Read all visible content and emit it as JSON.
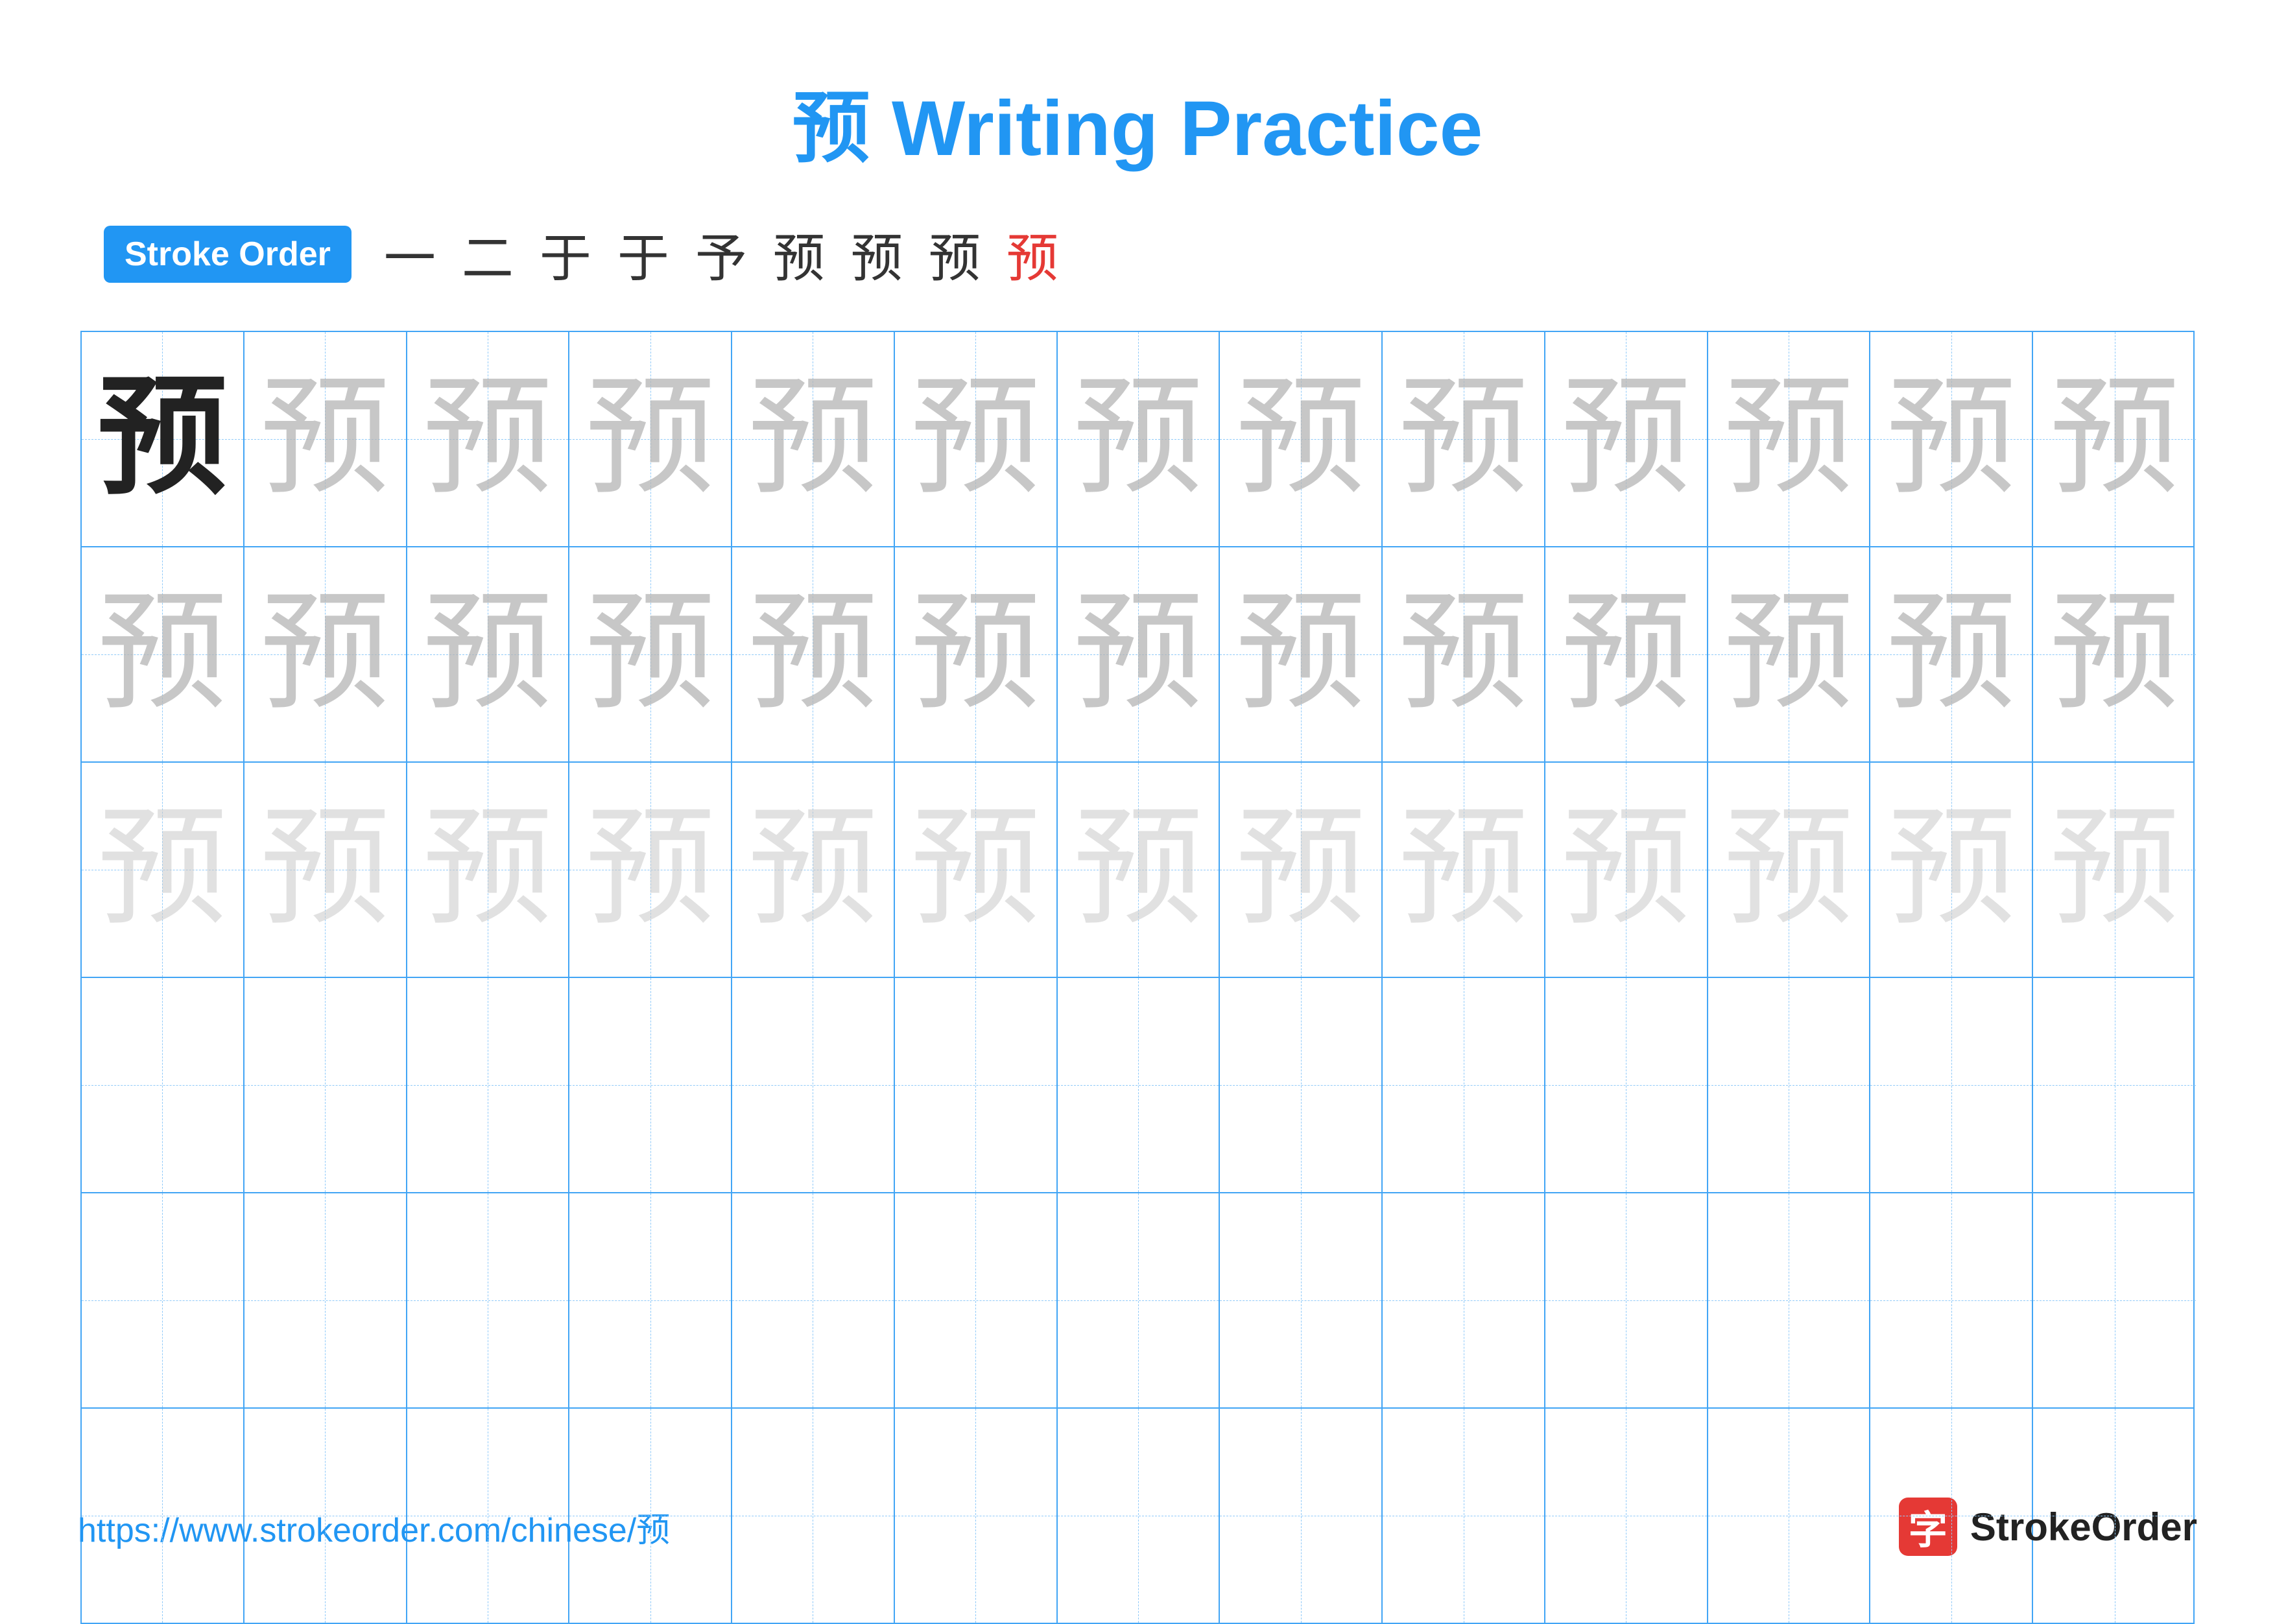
{
  "title": "预 Writing Practice",
  "stroke_order": {
    "badge_label": "Stroke Order",
    "strokes": [
      "一",
      "二",
      "于",
      "于",
      "予",
      "预",
      "预",
      "预",
      "预"
    ]
  },
  "grid": {
    "rows": 6,
    "cols": 13,
    "char": "预",
    "row_types": [
      "solid-then-light1",
      "light1",
      "light2",
      "empty",
      "empty",
      "empty"
    ]
  },
  "footer": {
    "url": "https://www.strokeorder.com/chinese/预",
    "logo_char": "字",
    "logo_text": "StrokeOrder"
  }
}
